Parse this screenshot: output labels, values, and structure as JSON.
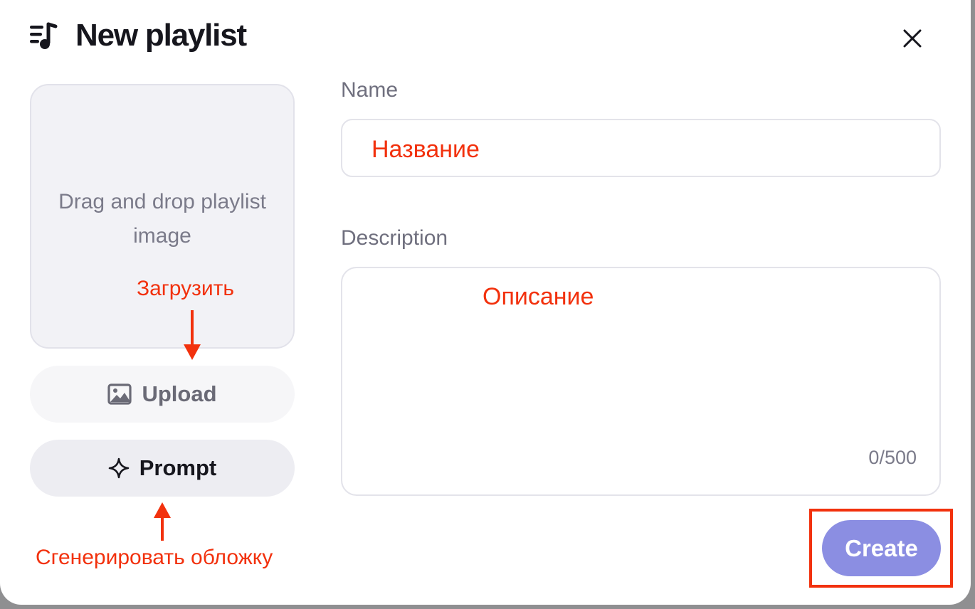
{
  "dialog": {
    "title": "New playlist",
    "title_icon": "playlist-music-icon",
    "close_icon": "close-icon"
  },
  "dropzone": {
    "text": "Drag and drop playlist image"
  },
  "buttons": {
    "upload_label": "Upload",
    "upload_icon": "image-icon",
    "prompt_label": "Prompt",
    "prompt_icon": "sparkle-icon",
    "create_label": "Create"
  },
  "form": {
    "name_label": "Name",
    "description_label": "Description",
    "description_counter": "0/500"
  },
  "annotations": {
    "upload": "Загрузить",
    "prompt": "Сгенерировать обложку",
    "name": "Название",
    "description": "Описание"
  },
  "colors": {
    "accent": "#8b8ee2",
    "annotation": "#f2310d",
    "text": "#16161d",
    "muted": "#7b7b8a"
  }
}
